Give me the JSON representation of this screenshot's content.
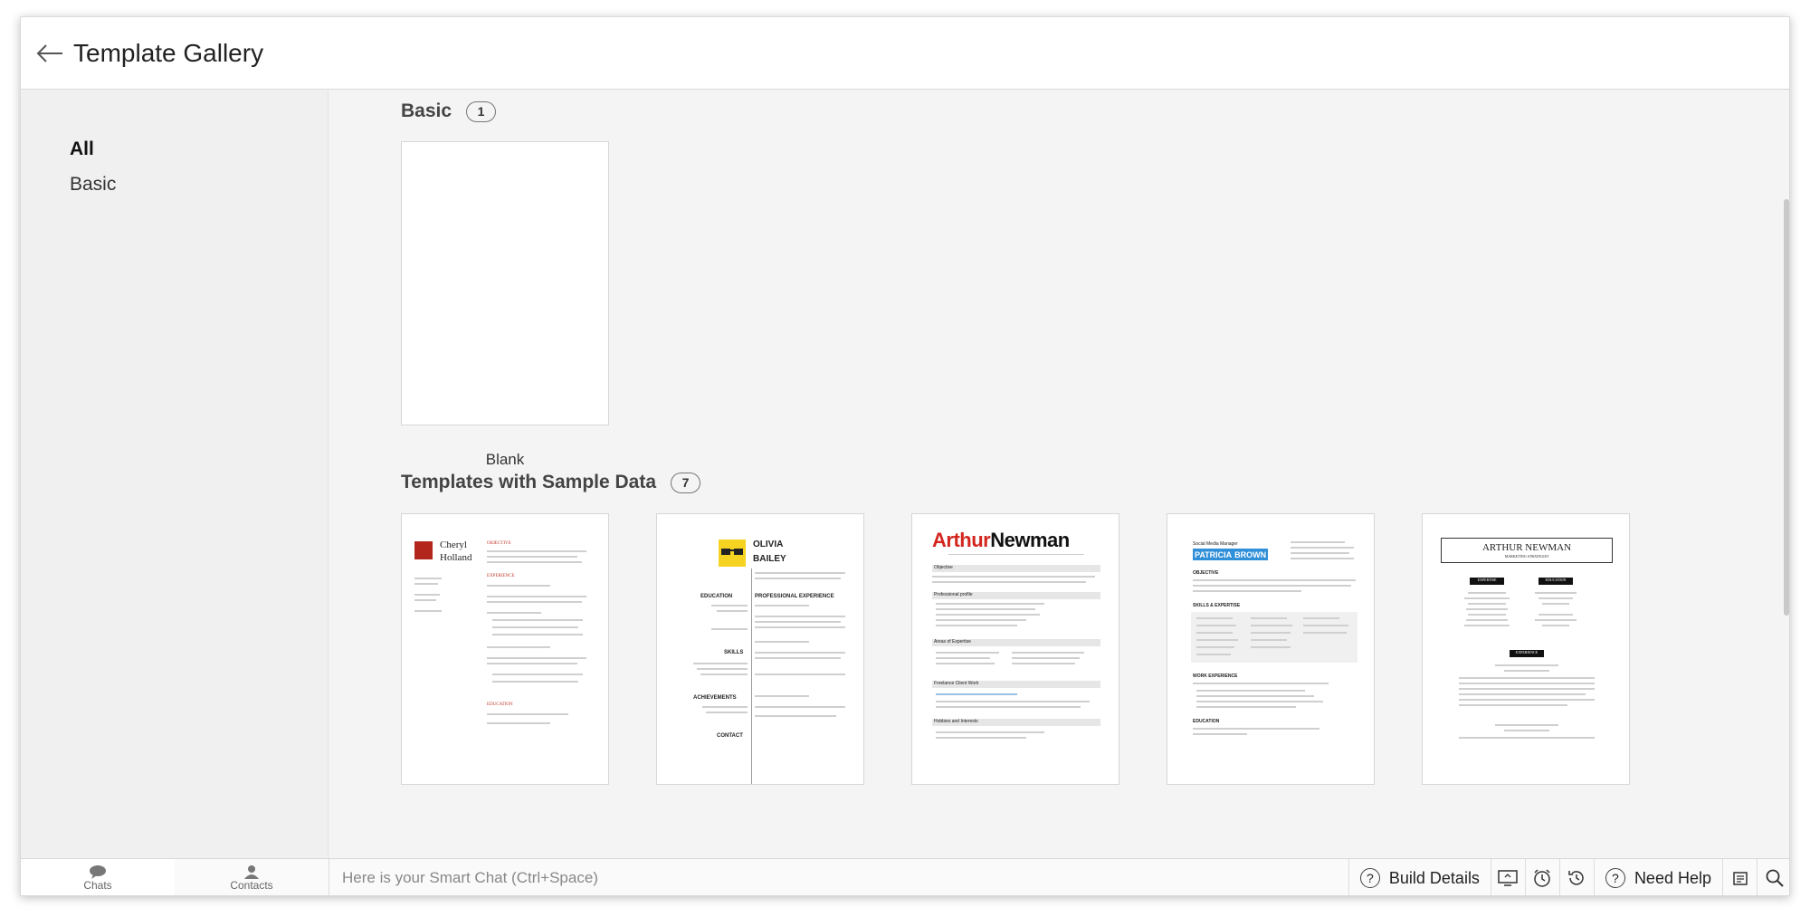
{
  "header": {
    "title": "Template Gallery"
  },
  "sidebar": {
    "items": [
      {
        "label": "All"
      },
      {
        "label": "Basic"
      }
    ]
  },
  "sections": {
    "basic": {
      "title": "Basic",
      "count": "1",
      "cards": [
        {
          "label": "Blank"
        }
      ]
    },
    "sample": {
      "title": "Templates with Sample Data",
      "count": "7",
      "cards": [
        {
          "name_first": "Cheryl",
          "name_last": "Holland",
          "heading1": "OBJECTIVE",
          "heading2": "EXPERIENCE",
          "heading3": "EDUCATION"
        },
        {
          "name_first": "OLIVIA",
          "name_last": "BAILEY",
          "heading1": "EDUCATION",
          "heading2": "PROFESSIONAL EXPERIENCE",
          "heading3": "SKILLS",
          "heading4": "ACHIEVEMENTS",
          "heading5": "CONTACT"
        },
        {
          "name_first": "Arthur",
          "name_last": "Newman",
          "heading1": "Objective",
          "heading2": "Professional profile",
          "heading3": "Areas of Expertise",
          "heading4": "Freelance Client Work",
          "heading5": "Hobbies and Interests"
        },
        {
          "role": "Social Media Manager",
          "name_first": "PATRICIA",
          "name_last": "BROWN",
          "heading1": "OBJECTIVE",
          "heading2": "SKILLS & EXPERTISE",
          "heading3": "WORK EXPERIENCE",
          "heading4": "EDUCATION"
        },
        {
          "name": "ARTHUR NEWMAN",
          "role": "MARKETING STRATEGIST",
          "heading1": "EXPERTISE",
          "heading2": "EDUCATION",
          "heading3": "EXPERIENCE"
        }
      ]
    }
  },
  "bottombar": {
    "chats_label": "Chats",
    "contacts_label": "Contacts",
    "smart_chat_placeholder": "Here is your Smart Chat (Ctrl+Space)",
    "build_details_label": "Build Details",
    "need_help_label": "Need Help"
  },
  "colors": {
    "accent_red": "#d3261f",
    "accent_yellow": "#f5d320",
    "accent_blue": "#2f8fd8",
    "card_red": "#b3261e"
  }
}
